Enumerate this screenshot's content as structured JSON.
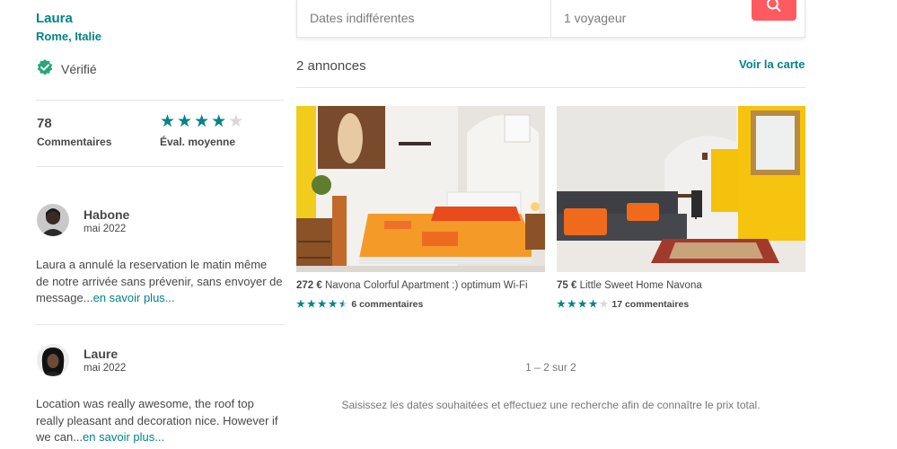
{
  "host": {
    "name": "Laura",
    "location": "Rome, Italie",
    "verified_label": "Vérifié"
  },
  "stats": {
    "reviews_count": "78",
    "reviews_label": "Commentaires",
    "rating_label": "Éval. moyenne",
    "rating_stars": 4
  },
  "reviews": [
    {
      "name": "Habone",
      "date": "mai 2022",
      "text": "Laura a annulé la reservation le matin même de notre arrivée sans prévenir, sans envoyer de message...",
      "more": "en savoir plus..."
    },
    {
      "name": "Laure",
      "date": "mai 2022",
      "text": "Location was really awesome, the roof top really pleasant and decoration nice. However if we can...",
      "more": "en savoir plus..."
    }
  ],
  "search": {
    "dates": "Dates indifférentes",
    "guests": "1 voyageur",
    "button_icon": "search-icon"
  },
  "listings": {
    "count_label": "2 annonces",
    "map_link": "Voir la carte",
    "items": [
      {
        "price": "272 €",
        "title": "Navona Colorful Apartment :) optimum Wi-Fi",
        "stars": 4.5,
        "reviews": "6 commentaires"
      },
      {
        "price": "75 €",
        "title": "Little Sweet Home Navona",
        "stars": 4,
        "reviews": "17 commentaires"
      }
    ]
  },
  "pagination": "1 – 2 sur 2",
  "note": "Saisissez les dates souhaitées et effectuez une recherche afin de connaître le prix total.",
  "colors": {
    "accent": "#008489",
    "brand": "#ff5a5f",
    "text": "#484848"
  }
}
